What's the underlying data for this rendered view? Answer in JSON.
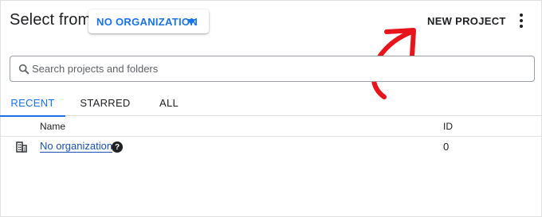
{
  "header": {
    "title": "Select from",
    "org_selector_label": "NO ORGANIZATION",
    "new_project_label": "NEW PROJECT",
    "menu_icon": "more-vert-icon"
  },
  "search": {
    "placeholder": "Search projects and folders",
    "value": ""
  },
  "tabs": [
    {
      "label": "RECENT",
      "active": true
    },
    {
      "label": "STARRED",
      "active": false
    },
    {
      "label": "ALL",
      "active": false
    }
  ],
  "table": {
    "columns": [
      "Name",
      "ID"
    ],
    "rows": [
      {
        "icon": "organization-icon",
        "name": "No organization",
        "id": "0",
        "help_icon": "help-icon"
      }
    ]
  },
  "colors": {
    "accent": "#1a73e8",
    "annotation": "#e8141c",
    "text": "#202124"
  }
}
